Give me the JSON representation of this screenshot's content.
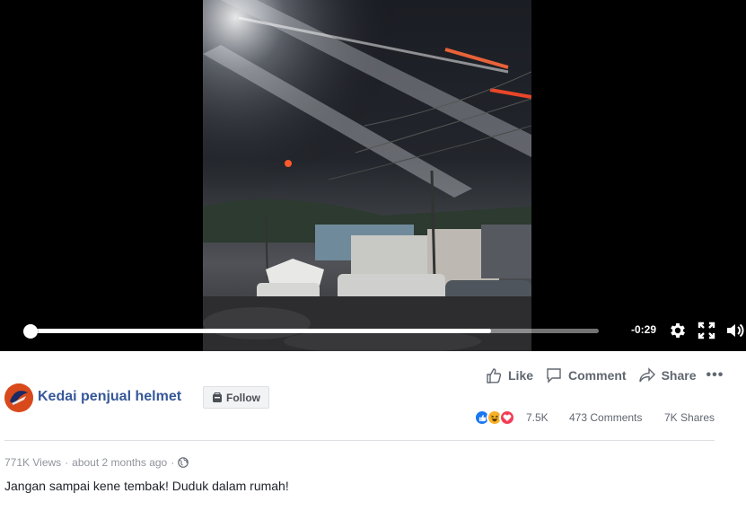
{
  "video": {
    "progress_fraction": 0.81,
    "time_remaining": "-0:29",
    "settings_icon": "gear-icon",
    "fullscreen_icon": "fullscreen-icon",
    "volume_icon": "volume-icon"
  },
  "post": {
    "page_name": "Kedai penjual helmet",
    "follow_label": "Follow",
    "actions": {
      "like": "Like",
      "comment": "Comment",
      "share": "Share",
      "more": "•••"
    },
    "reactions": [
      "like",
      "haha",
      "love"
    ],
    "reaction_count": "7.5K",
    "comments_count": "473 Comments",
    "shares_count": "7K Shares",
    "views": "771K Views",
    "time_posted": "about 2 months ago",
    "separator": "·",
    "privacy_icon": "globe-icon",
    "caption": "Jangan sampai kene tembak! Duduk dalam rumah!"
  },
  "colors": {
    "page_name": "#365899",
    "logo_bg": "#d84a1b",
    "like_blue": "#1877f2",
    "haha_yellow": "#f7b125",
    "love_red": "#f33e58"
  }
}
